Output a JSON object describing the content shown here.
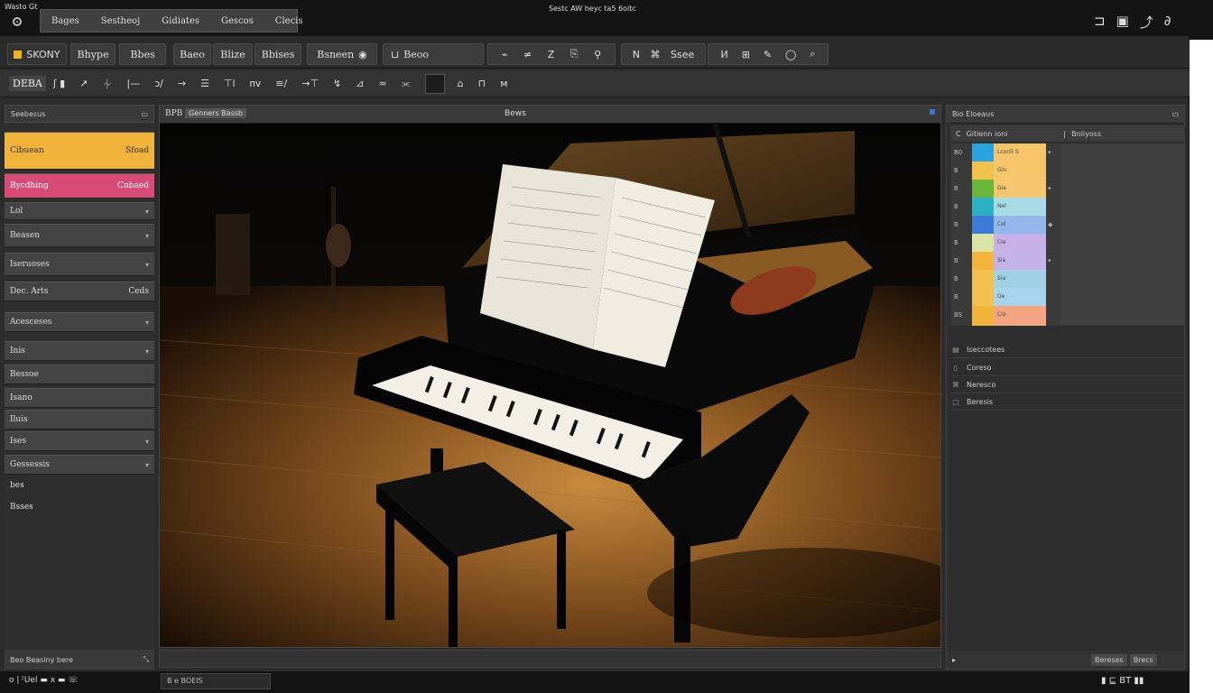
{
  "app": {
    "name": "Wasto Gt",
    "window_title": "Sestc AW heyc ta5 6oitc",
    "tabs": [
      "Bages",
      "Sestheoj",
      "Gidiates",
      "Gescos",
      "Clecis"
    ]
  },
  "toolbar1": {
    "brand": "SKONY",
    "buttons": [
      "Bhype",
      "Bbes",
      "Baeo",
      "Blize",
      "Bbises",
      "Bsneen",
      "Beoo",
      "Ssee"
    ],
    "glyphs_a": [
      "⌁",
      "≠",
      "Z",
      "⎘",
      "⚲"
    ],
    "glyphs_b": [
      "N",
      "⌘"
    ],
    "glyphs_c": [
      "I⁄I",
      "⊞",
      "✎",
      "◯",
      "⌕"
    ]
  },
  "toolbar2": {
    "label": "DEBA",
    "icons": [
      "ʃ ▮",
      "↗",
      "⏆",
      "|—",
      "ᴐ/",
      "→",
      "☰",
      "⊤l",
      "ᴨᴠ",
      "≡/",
      "→⊤",
      "↯",
      "⊿",
      "≈",
      "⫘",
      "⌂",
      "⊓",
      "ᴍ"
    ]
  },
  "left_panel": {
    "header": "Seebesus",
    "rows": [
      {
        "left": "Cibuean",
        "right": "Sfoad"
      },
      {
        "left": "Bycdhing",
        "right": "Cnbaed"
      },
      {
        "left": "Lol",
        "right": ""
      },
      {
        "left": "Beasen",
        "right": ""
      },
      {
        "left": "Iseruoses",
        "right": ""
      },
      {
        "left": "Dec. Arts",
        "right": "Ceds"
      },
      {
        "left": "Acesceses",
        "right": ""
      },
      {
        "left": "Inis",
        "right": ""
      },
      {
        "left": "Bessoe",
        "right": ""
      },
      {
        "left": "Isano",
        "right": ""
      },
      {
        "left": "Iluis",
        "right": ""
      },
      {
        "left": "Ises",
        "right": ""
      },
      {
        "left": "Gessessis",
        "right": ""
      },
      {
        "left": "bes",
        "right": ""
      },
      {
        "left": "Bsses",
        "right": ""
      }
    ],
    "footer": "Beo Beasiny bere"
  },
  "viewport": {
    "header_left": "BPB",
    "breadcrumb": "Genners Bassb",
    "header_center": "Bews"
  },
  "right_panel": {
    "header": "Bio Eloeaus",
    "sub_left": "Gitlenn ioni",
    "sub_right": "Bniiyoss",
    "swatches": [
      {
        "num": "B0",
        "c1": "#2aa4e0",
        "c2": "#f6c46a",
        "label": "Lcon5 S"
      },
      {
        "num": "B",
        "c1": "#f2c04c",
        "c2": "#f5c56c",
        "label": "Gin"
      },
      {
        "num": "B",
        "c1": "#6ab63a",
        "c2": "#f6c66e",
        "label": "Gie"
      },
      {
        "num": "B",
        "c1": "#2cb0c4",
        "c2": "#a8dbe6",
        "label": "Nel"
      },
      {
        "num": "B",
        "c1": "#3b7ad6",
        "c2": "#95b6ea",
        "label": "Cel"
      },
      {
        "num": "B",
        "c1": "#d9e4a6",
        "c2": "#c6b0e6",
        "label": "Cie"
      },
      {
        "num": "B",
        "c1": "#f2b43a",
        "c2": "#c5b2e8",
        "label": "Sia"
      },
      {
        "num": "B",
        "c1": "#f2c04c",
        "c2": "#9fd0e4",
        "label": "Sia"
      },
      {
        "num": "B",
        "c1": "#f2c04c",
        "c2": "#a7d4ea",
        "label": "Oe"
      },
      {
        "num": "BS",
        "c1": "#f0b43a",
        "c2": "#f4a480",
        "label": "Cio"
      }
    ],
    "marks": [
      "▾",
      "",
      "▾",
      "",
      "◆",
      "",
      "▾",
      "",
      "",
      ""
    ],
    "list": [
      "Iseccotees",
      "Coreso",
      "Neresco",
      "Beresis"
    ],
    "footer_a": "Bereses",
    "footer_b": "Brecs"
  },
  "bottom": {
    "left": "o | ᶴUel ▬ x ▬ ☏",
    "input": "B e BOEIS",
    "right": "▮ ⊑ BT ▮▮"
  }
}
